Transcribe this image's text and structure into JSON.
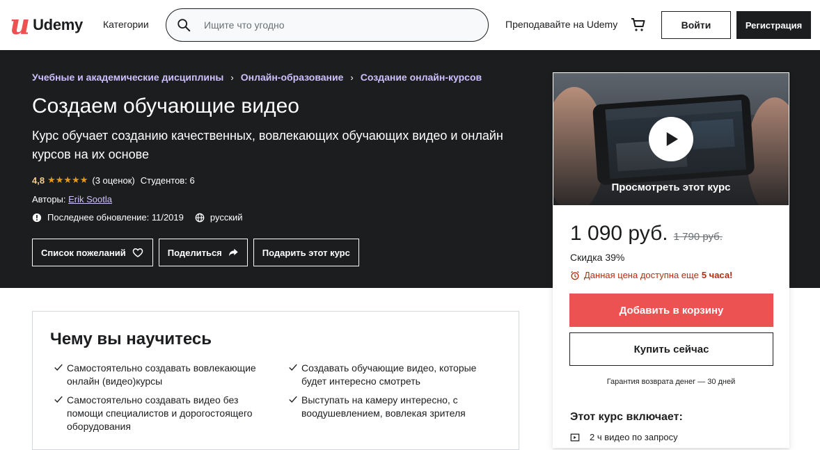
{
  "header": {
    "logo_mark": "u",
    "logo_text": "Udemy",
    "categories_label": "Категории",
    "search_placeholder": "Ищите что угодно",
    "teach_label": "Преподавайте на Udemy",
    "cart_icon": "cart-icon",
    "login_label": "Войти",
    "signup_label": "Регистрация"
  },
  "breadcrumbs": [
    "Учебные и академические дисциплины",
    "Онлайн-образование",
    "Создание онлайн-курсов"
  ],
  "course": {
    "title": "Создаем обучающие видео",
    "subtitle": "Курс обучает созданию качественных, вовлекающих обучающих видео и онлайн курсов на их основе",
    "rating_value": "4,8",
    "stars": "★★★★★",
    "rating_count": "(3 оценок)",
    "students": "Студентов: 6",
    "authors_label": "Авторы:",
    "author_name": "Erik Sootla",
    "updated": "Последнее обновление: 11/2019",
    "language": "русский"
  },
  "actions": {
    "wishlist": "Список пожеланий",
    "share": "Поделиться",
    "gift": "Подарить этот курс"
  },
  "sidebar": {
    "preview_label": "Просмотреть этот курс",
    "price": "1 090 руб.",
    "old_price": "1 790 руб.",
    "discount": "Скидка 39%",
    "timer_text": "Данная цена доступна еще",
    "timer_bold": "5 часа!",
    "add_to_cart": "Добавить в корзину",
    "buy_now": "Купить сейчас",
    "guarantee": "Гарантия возврата денег — 30 дней",
    "includes_title": "Этот курс включает:",
    "includes_item": "2 ч видео по запросу"
  },
  "learn": {
    "title": "Чему вы научитесь",
    "items": [
      "Самостоятельно создавать вовлекающие онлайн (видео)курсы",
      "Создавать обучающие видео, которые будет интересно смотреть",
      "Самостоятельно создавать видео без помощи специалистов и дорогостоящего оборудования",
      "Выступать на камеру интересно, с воодушевлением, вовлекая зрителя"
    ]
  },
  "colors": {
    "accent_red": "#ec5252",
    "dark_bg": "#1c1d1f",
    "link_purple": "#cec0fc",
    "star_orange": "#e59819",
    "timer_red": "#b32d0f"
  }
}
